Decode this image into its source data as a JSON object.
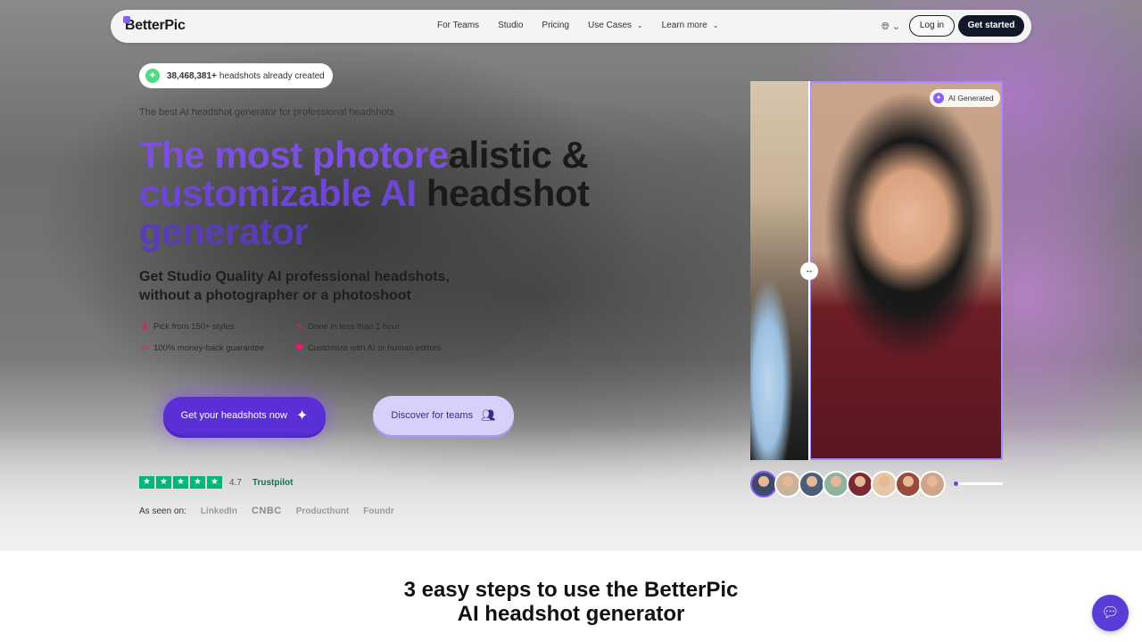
{
  "nav": {
    "logo": "BetterPic",
    "links": [
      {
        "label": "For Teams"
      },
      {
        "label": "Studio"
      },
      {
        "label": "Pricing"
      },
      {
        "label": "Use Cases",
        "dropdown": true
      },
      {
        "label": "Learn more",
        "dropdown": true
      }
    ],
    "globe_icon": "globe-icon",
    "login_label": "Log in",
    "get_started_label": "Get started"
  },
  "hero": {
    "badge_count": "38,468,381+",
    "badge_text": "headshots already created",
    "tagline": "The best AI headshot generator for professional headshots",
    "headline": {
      "line1_highlight": "The most photore",
      "line1_rest": "alistic &",
      "line2_highlight": "customizable AI",
      "line2_rest": " headshot",
      "line3": "generator"
    },
    "subhead": "Get Studio Quality AI professional headshots, without a photographer or a photoshoot",
    "features": [
      {
        "label": "Pick from 150+ styles",
        "icon": "dress-icon"
      },
      {
        "label": "Done in less than 1 hour",
        "icon": "lightning-icon"
      },
      {
        "label": "100% money-back guarantee",
        "icon": "money-icon"
      },
      {
        "label": "Customize with AI or human editors",
        "icon": "shield-icon"
      }
    ],
    "cta_primary": "Get your headshots now",
    "cta_secondary": "Discover for teams",
    "rating": {
      "score": "4.7",
      "brand": "Trustpilot",
      "stars": 5
    },
    "seen_on_label": "As seen on:",
    "seen_on_logos": [
      "LinkedIn",
      "CNBC",
      "Producthunt",
      "Foundr"
    ]
  },
  "compare": {
    "ai_label": "AI Generated",
    "thumbs": [
      "#3c4a6b",
      "#c9b29a",
      "#4a5e7a",
      "#8fb3a0",
      "#7a2a35",
      "#e3c7a8",
      "#9a4a3a",
      "#cfa58a"
    ]
  },
  "steps": {
    "title": "3 easy steps to use the BetterPic AI headshot generator"
  },
  "colors": {
    "brand_purple": "#6d46d4",
    "accent_purple": "#8b5cf6",
    "trustpilot_green": "#00b67a",
    "dark": "#111827"
  }
}
